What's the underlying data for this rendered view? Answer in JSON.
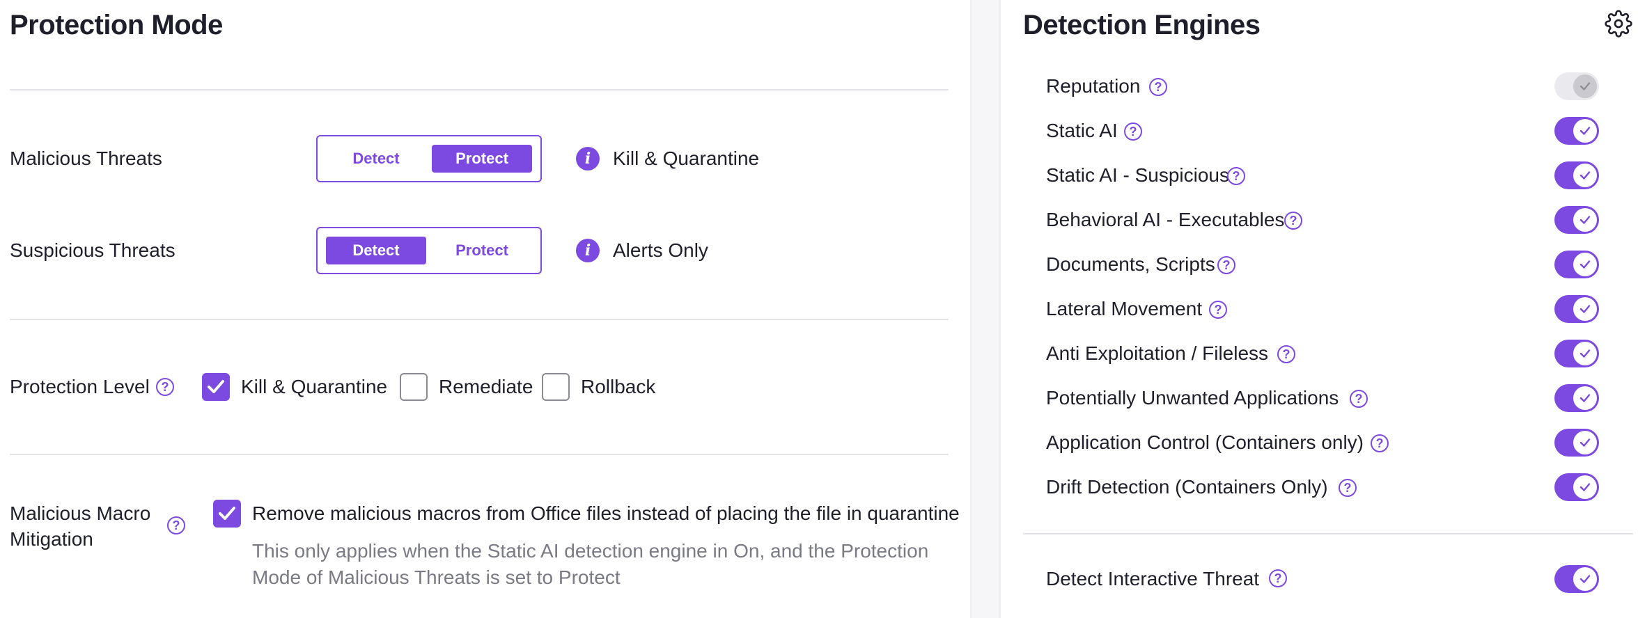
{
  "protection_mode": {
    "title": "Protection Mode",
    "malicious_threats": {
      "label": "Malicious Threats",
      "detect_label": "Detect",
      "protect_label": "Protect",
      "selected": "Protect",
      "status_text": "Kill & Quarantine"
    },
    "suspicious_threats": {
      "label": "Suspicious Threats",
      "detect_label": "Detect",
      "protect_label": "Protect",
      "selected": "Detect",
      "status_text": "Alerts Only"
    },
    "protection_level": {
      "label": "Protection Level",
      "options": [
        {
          "label": "Kill & Quarantine",
          "checked": true
        },
        {
          "label": "Remediate",
          "checked": false
        },
        {
          "label": "Rollback",
          "checked": false
        }
      ]
    },
    "macro_mitigation": {
      "label_line1": "Malicious Macro",
      "label_line2": "Mitigation",
      "checkbox_label": "Remove malicious macros from Office files instead of placing the file in quarantine",
      "checked": true,
      "note_line1": "This only applies when the Static AI detection engine in On, and the Protection",
      "note_line2": "Mode of Malicious Threats is set to Protect"
    }
  },
  "detection_engines": {
    "title": "Detection Engines",
    "engines": [
      {
        "label": "Reputation",
        "enabled": true,
        "disabled": true
      },
      {
        "label": "Static AI",
        "enabled": true
      },
      {
        "label": "Static AI - Suspicious",
        "enabled": true
      },
      {
        "label": "Behavioral AI - Executables",
        "enabled": true
      },
      {
        "label": "Documents, Scripts",
        "enabled": true
      },
      {
        "label": "Lateral Movement",
        "enabled": true
      },
      {
        "label": "Anti Exploitation / Fileless",
        "enabled": true
      },
      {
        "label": "Potentially Unwanted Applications",
        "enabled": true
      },
      {
        "label": "Application Control (Containers only)",
        "enabled": true
      },
      {
        "label": "Drift Detection (Containers Only)",
        "enabled": true
      }
    ],
    "interactive_threat": {
      "label": "Detect Interactive Threat",
      "enabled": true
    }
  },
  "icons": {
    "help": "question-mark",
    "info": "i",
    "settings": "gear-icon",
    "check": "check-icon"
  },
  "colors": {
    "accent": "#7c4ae0",
    "text": "#1f1f2b",
    "muted": "#7a7a85",
    "divider": "#e3e3e8"
  }
}
